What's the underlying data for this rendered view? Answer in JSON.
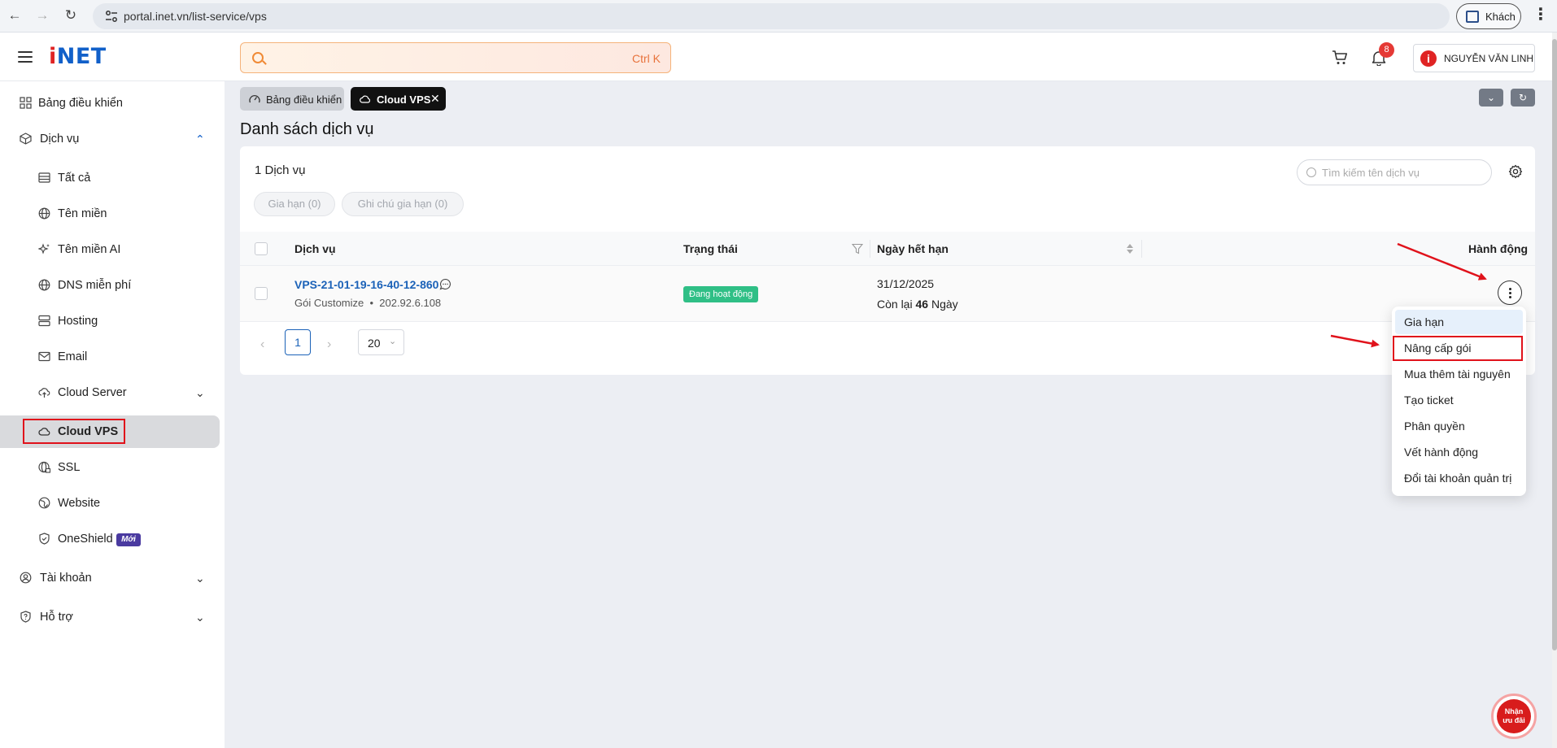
{
  "browser": {
    "url": "portal.inet.vn/list-service/vps",
    "profile_label": "Khách"
  },
  "header": {
    "logo": "iNET",
    "search_shortcut": "Ctrl K",
    "notification_count": "8",
    "user_name": "NGUYỄN VĂN LINH"
  },
  "sidebar": {
    "items": [
      {
        "label": "Bảng điều khiển"
      },
      {
        "label": "Dịch vụ"
      },
      {
        "label": "Tất cả"
      },
      {
        "label": "Tên miền"
      },
      {
        "label": "Tên miền AI"
      },
      {
        "label": "DNS miễn phí"
      },
      {
        "label": "Hosting"
      },
      {
        "label": "Email"
      },
      {
        "label": "Cloud Server"
      },
      {
        "label": "Cloud VPS"
      },
      {
        "label": "SSL"
      },
      {
        "label": "Website"
      },
      {
        "label": "OneShield"
      },
      {
        "label": "Tài khoản"
      },
      {
        "label": "Hỗ trợ"
      }
    ],
    "new_badge": "Mới"
  },
  "tabs": [
    {
      "label": "Bảng điều khiển"
    },
    {
      "label": "Cloud VPS"
    }
  ],
  "main": {
    "title": "Danh sách dịch vụ",
    "count_label": "1 Dịch vụ",
    "chips": [
      "Gia hạn (0)",
      "Ghi chú gia hạn (0)"
    ],
    "search_placeholder": "Tìm kiếm tên dịch vụ",
    "columns": [
      "Dịch vụ",
      "Trạng thái",
      "Ngày hết hạn",
      "Hành động"
    ],
    "rows": [
      {
        "name": "VPS-21-01-19-16-40-12-860",
        "package": "Gói Customize",
        "ip": "202.92.6.108",
        "status": "Đang hoạt động",
        "expiry_date": "31/12/2025",
        "remaining_prefix": "Còn lại",
        "remaining_days": "46",
        "remaining_suffix": "Ngày"
      }
    ],
    "pagination": {
      "current_page": "1",
      "page_size": "20"
    }
  },
  "action_menu": {
    "items": [
      "Gia hạn",
      "Nâng cấp gói",
      "Mua thêm tài nguyên",
      "Tạo ticket",
      "Phân quyền",
      "Vết hành động",
      "Đổi tài khoản quản trị"
    ]
  },
  "promo": {
    "line1": "Nhận",
    "line2": "ưu đãi"
  },
  "colors": {
    "brand_blue": "#1160c9",
    "status_green": "#2fbf86",
    "annotation_red": "#e0121b"
  }
}
